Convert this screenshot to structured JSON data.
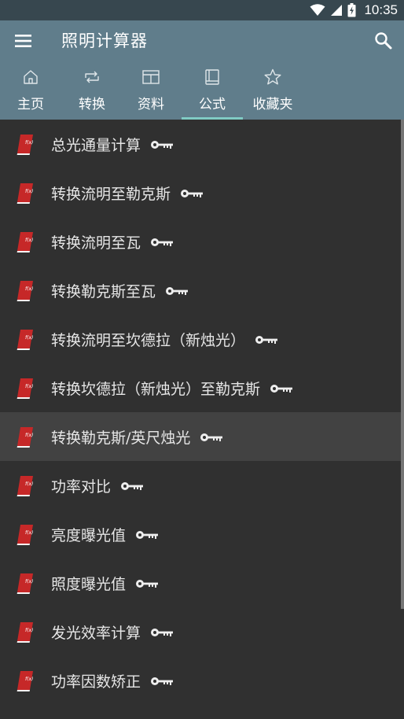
{
  "status_bar": {
    "time": "10:35"
  },
  "app_bar": {
    "title": "照明计算器"
  },
  "tabs": [
    {
      "label": "主页",
      "icon": "home-icon"
    },
    {
      "label": "转换",
      "icon": "repeat-icon"
    },
    {
      "label": "资料",
      "icon": "table-icon"
    },
    {
      "label": "公式",
      "icon": "book-icon"
    },
    {
      "label": "收藏夹",
      "icon": "star-icon"
    }
  ],
  "active_tab": "公式",
  "colors": {
    "app_bar": "#607d8b",
    "status_bar": "#37474f",
    "background": "#303030",
    "selected_row": "#424242",
    "tab_indicator": "#80cbc4",
    "book_icon": "#c62828"
  },
  "formulas": [
    {
      "label": "总光通量计算"
    },
    {
      "label": "转换流明至勒克斯"
    },
    {
      "label": "转换流明至瓦"
    },
    {
      "label": "转换勒克斯至瓦"
    },
    {
      "label": "转换流明至坎德拉（新烛光）"
    },
    {
      "label": "转换坎德拉（新烛光）至勒克斯"
    },
    {
      "label": "转换勒克斯/英尺烛光"
    },
    {
      "label": "功率对比"
    },
    {
      "label": "亮度曝光值"
    },
    {
      "label": "照度曝光值"
    },
    {
      "label": "发光效率计算"
    },
    {
      "label": "功率因数矫正"
    }
  ],
  "selected_index": 6
}
